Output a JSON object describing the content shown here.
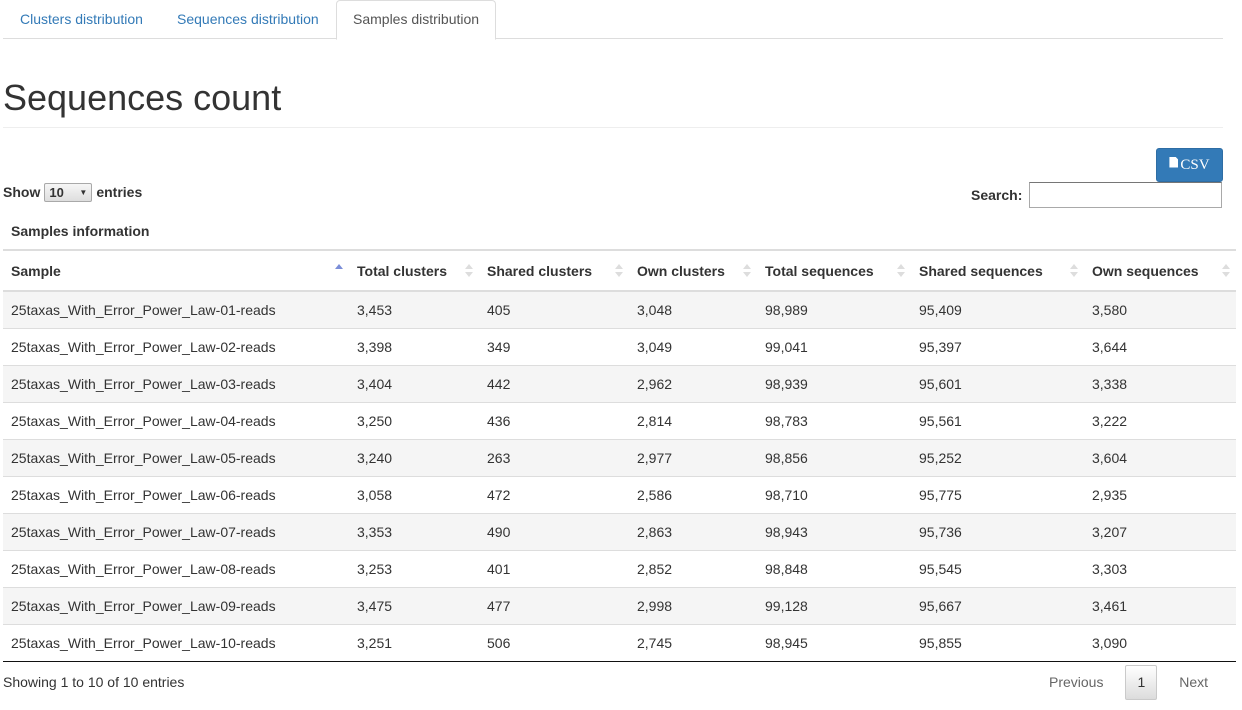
{
  "tabs": [
    {
      "label": "Clusters distribution"
    },
    {
      "label": "Sequences distribution"
    },
    {
      "label": "Samples distribution"
    }
  ],
  "page_title": "Sequences count",
  "csv_button": {
    "label": "CSV",
    "icon": "file-icon"
  },
  "length_control": {
    "show_label": "Show",
    "selected": "10",
    "entries_label": "entries"
  },
  "search": {
    "label": "Search:",
    "value": ""
  },
  "table": {
    "caption": "Samples information",
    "columns": [
      "Sample",
      "Total clusters",
      "Shared clusters",
      "Own clusters",
      "Total sequences",
      "Shared sequences",
      "Own sequences"
    ],
    "sorted_column": "Sample",
    "sort_direction": "ascending",
    "rows": [
      [
        "25taxas_With_Error_Power_Law-01-reads",
        "3,453",
        "405",
        "3,048",
        "98,989",
        "95,409",
        "3,580"
      ],
      [
        "25taxas_With_Error_Power_Law-02-reads",
        "3,398",
        "349",
        "3,049",
        "99,041",
        "95,397",
        "3,644"
      ],
      [
        "25taxas_With_Error_Power_Law-03-reads",
        "3,404",
        "442",
        "2,962",
        "98,939",
        "95,601",
        "3,338"
      ],
      [
        "25taxas_With_Error_Power_Law-04-reads",
        "3,250",
        "436",
        "2,814",
        "98,783",
        "95,561",
        "3,222"
      ],
      [
        "25taxas_With_Error_Power_Law-05-reads",
        "3,240",
        "263",
        "2,977",
        "98,856",
        "95,252",
        "3,604"
      ],
      [
        "25taxas_With_Error_Power_Law-06-reads",
        "3,058",
        "472",
        "2,586",
        "98,710",
        "95,775",
        "2,935"
      ],
      [
        "25taxas_With_Error_Power_Law-07-reads",
        "3,353",
        "490",
        "2,863",
        "98,943",
        "95,736",
        "3,207"
      ],
      [
        "25taxas_With_Error_Power_Law-08-reads",
        "3,253",
        "401",
        "2,852",
        "98,848",
        "95,545",
        "3,303"
      ],
      [
        "25taxas_With_Error_Power_Law-09-reads",
        "3,475",
        "477",
        "2,998",
        "99,128",
        "95,667",
        "3,461"
      ],
      [
        "25taxas_With_Error_Power_Law-10-reads",
        "3,251",
        "506",
        "2,745",
        "98,945",
        "95,855",
        "3,090"
      ]
    ]
  },
  "footer": {
    "info": "Showing 1 to 10 of 10 entries",
    "pagination": {
      "previous": "Previous",
      "current": "1",
      "next": "Next"
    }
  },
  "colors": {
    "accent": "#337ab7",
    "link": "#337ab7",
    "sort_active": "#7b8ed8"
  }
}
